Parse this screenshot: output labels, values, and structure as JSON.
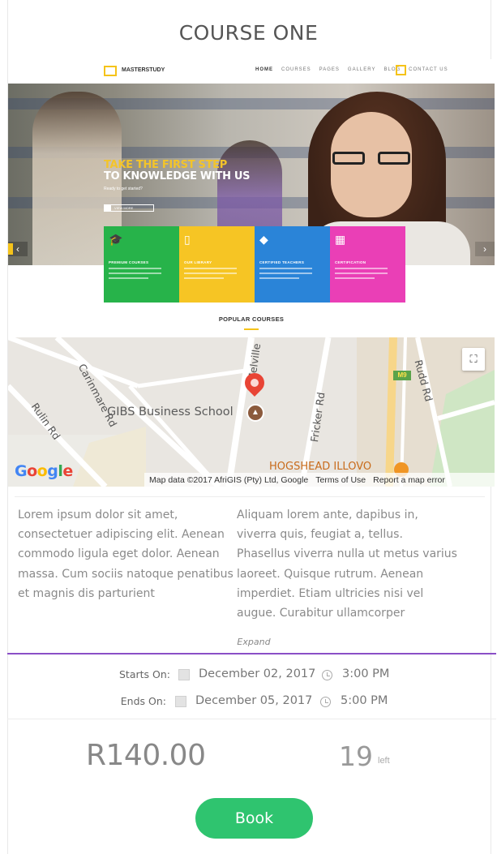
{
  "page": {
    "title": "COURSE ONE"
  },
  "preview": {
    "logo_text": "MASTERSTUDY",
    "menu": [
      "HOME",
      "COURSES",
      "PAGES",
      "GALLERY",
      "BLOG",
      "CONTACT US"
    ],
    "headline_1": "TAKE THE FIRST STEP",
    "headline_2": "TO KNOWLEDGE WITH US",
    "subline": "Ready to get started?",
    "button_label": "VIEW MORE",
    "features": [
      {
        "title": "PREMIUM COURSES",
        "color": "#27b34a",
        "icon": "graduation-cap-icon",
        "glyph": "🎓"
      },
      {
        "title": "OUR LIBRARY",
        "color": "#f6c524",
        "icon": "book-icon",
        "glyph": "▯"
      },
      {
        "title": "CERTIFIED TEACHERS",
        "color": "#2a84d8",
        "icon": "diamond-icon",
        "glyph": "◆"
      },
      {
        "title": "CERTIFICATION",
        "color": "#ea3fb6",
        "icon": "certificate-icon",
        "glyph": "▦"
      }
    ],
    "popular_heading": "POPULAR COURSES"
  },
  "map": {
    "streets": {
      "carinmare": "Carinmare Rd",
      "melville": "Melville",
      "rulin": "Rulin Rd",
      "fricker": "Fricker Rd",
      "rudd": "Rudd Rd"
    },
    "route_badge": "M9",
    "place_name": "GIBS Business School",
    "other_place": "HOGSHEAD ILLOVO",
    "google_logo": "Google",
    "attribution": "Map data ©2017 AfriGIS (Pty) Ltd, Google",
    "terms": "Terms of Use",
    "report": "Report a map error"
  },
  "description": {
    "col1": "Lorem ipsum dolor sit amet, consectetuer adipiscing elit. Aenean commodo ligula eget dolor. Aenean massa. Cum sociis natoque penatibus et magnis dis parturient",
    "col2": "Aliquam lorem ante, dapibus in, viverra quis, feugiat a, tellus. Phasellus viverra nulla ut metus varius laoreet. Quisque rutrum. Aenean imperdiet. Etiam ultricies nisi vel augue. Curabitur ullamcorper",
    "expand_label": "Expand"
  },
  "schedule": {
    "starts_label": "Starts On:",
    "starts_date": "December 02, 2017",
    "starts_time": "3:00 PM",
    "ends_label": "Ends On:",
    "ends_date": "December 05, 2017",
    "ends_time": "5:00 PM"
  },
  "booking": {
    "price": "R140.00",
    "seats_left": "19",
    "seats_left_suffix": "left",
    "book_label": "Book",
    "accent_color": "#2fc46f"
  }
}
